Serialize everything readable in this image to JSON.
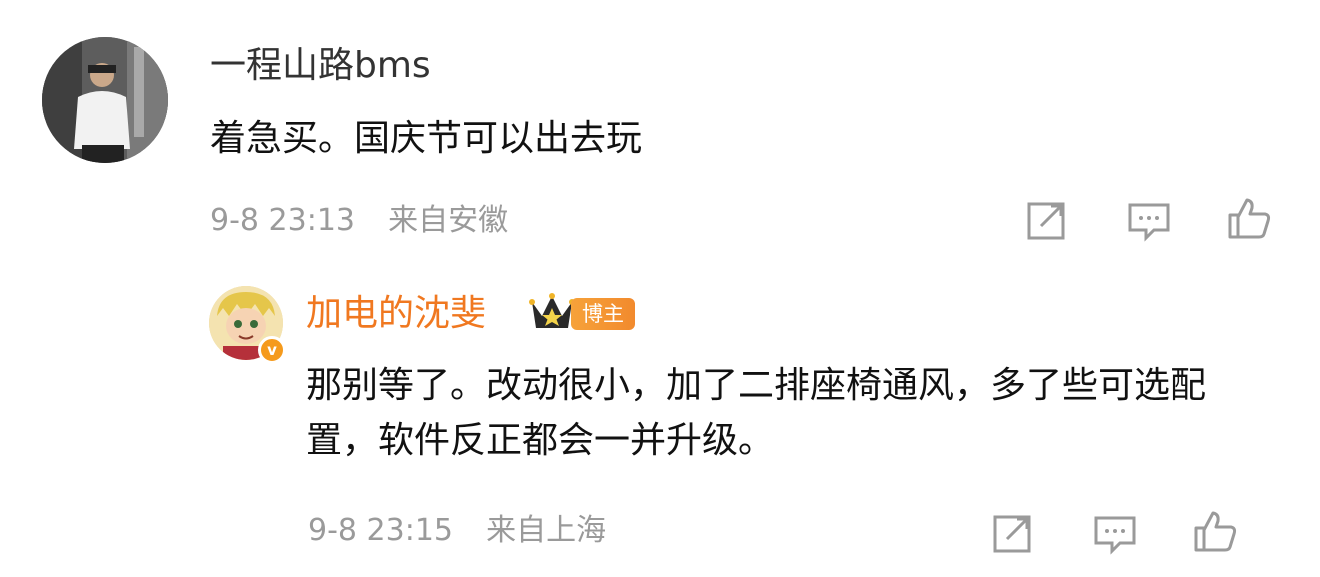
{
  "comment": {
    "username": "一程山路bms",
    "text": "着急买。国庆节可以出去玩",
    "timestamp": "9-8 23:13",
    "location": "来自安徽"
  },
  "reply": {
    "username": "加电的沈斐",
    "badge_label": "博主",
    "verified_mark": "v",
    "text": "那别等了。改动很小，加了二排座椅通风，多了些可选配置，软件反正都会一并升级。",
    "timestamp": "9-8 23:15",
    "location": "来自上海"
  },
  "colors": {
    "username_reply": "#f07820",
    "meta": "#9a9a9a",
    "badge": "#f28a2d"
  },
  "icons": [
    "share-icon",
    "comment-icon",
    "like-icon"
  ]
}
